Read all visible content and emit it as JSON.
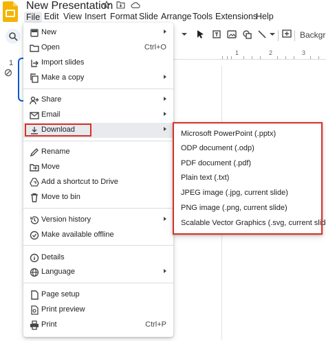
{
  "app": {
    "title": "New Presentation",
    "logo_color": "#f4b400"
  },
  "menubar": [
    "File",
    "Edit",
    "View",
    "Insert",
    "Format",
    "Slide",
    "Arrange",
    "Tools",
    "Extensions",
    "Help"
  ],
  "toolbar": {
    "background_label": "Backgro"
  },
  "ruler": [
    "1",
    "2",
    "3"
  ],
  "filmstrip": {
    "slide_number": "1"
  },
  "file_menu": {
    "groups": [
      [
        {
          "label": "New",
          "icon": "new-icon",
          "submenu": true
        },
        {
          "label": "Open",
          "icon": "folder-open-icon",
          "shortcut": "Ctrl+O"
        },
        {
          "label": "Import slides",
          "icon": "import-icon"
        },
        {
          "label": "Make a copy",
          "icon": "copy-icon",
          "submenu": true
        }
      ],
      [
        {
          "label": "Share",
          "icon": "share-icon",
          "submenu": true
        },
        {
          "label": "Email",
          "icon": "email-icon",
          "submenu": true
        },
        {
          "label": "Download",
          "icon": "download-icon",
          "submenu": true,
          "active": true
        }
      ],
      [
        {
          "label": "Rename",
          "icon": "rename-icon"
        },
        {
          "label": "Move",
          "icon": "move-icon"
        },
        {
          "label": "Add a shortcut to Drive",
          "icon": "drive-shortcut-icon"
        },
        {
          "label": "Move to bin",
          "icon": "trash-icon"
        }
      ],
      [
        {
          "label": "Version history",
          "icon": "history-icon",
          "submenu": true
        },
        {
          "label": "Make available offline",
          "icon": "offline-icon"
        }
      ],
      [
        {
          "label": "Details",
          "icon": "info-icon"
        },
        {
          "label": "Language",
          "icon": "globe-icon",
          "submenu": true
        }
      ],
      [
        {
          "label": "Page setup",
          "icon": "page-setup-icon"
        },
        {
          "label": "Print preview",
          "icon": "print-preview-icon"
        },
        {
          "label": "Print",
          "icon": "print-icon",
          "shortcut": "Ctrl+P"
        }
      ]
    ]
  },
  "download_menu": [
    "Microsoft PowerPoint (.pptx)",
    "ODP document (.odp)",
    "PDF document (.pdf)",
    "Plain text (.txt)",
    "JPEG image (.jpg, current slide)",
    "PNG image (.png, current slide)",
    "Scalable Vector Graphics (.svg, current slide)"
  ],
  "colors": {
    "highlight_box": "#d93025",
    "hover_bg": "#e8eaed",
    "text": "#202124",
    "accent": "#0b57d0"
  }
}
